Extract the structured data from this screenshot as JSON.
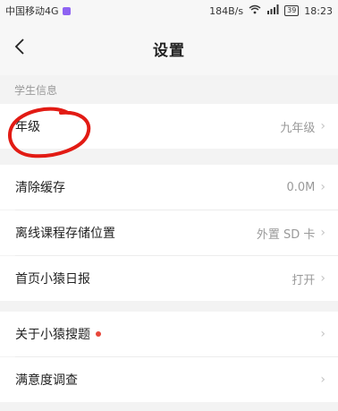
{
  "statusbar": {
    "carrier": "中国移动4G",
    "speed": "184B/s",
    "battery": "39",
    "time": "18:23"
  },
  "nav": {
    "title": "设置"
  },
  "sections": {
    "student_info_header": "学生信息"
  },
  "rows": {
    "grade": {
      "label": "年级",
      "value": "九年级"
    },
    "clear_cache": {
      "label": "清除缓存",
      "value": "0.0M"
    },
    "offline_storage": {
      "label": "离线课程存储位置",
      "value": "外置 SD 卡"
    },
    "daily_report": {
      "label": "首页小猿日报",
      "value": "打开"
    },
    "about": {
      "label": "关于小猿搜题"
    },
    "survey": {
      "label": "满意度调查"
    }
  },
  "colors": {
    "accent_dot": "#e8463a",
    "annotation": "#e21b14"
  }
}
